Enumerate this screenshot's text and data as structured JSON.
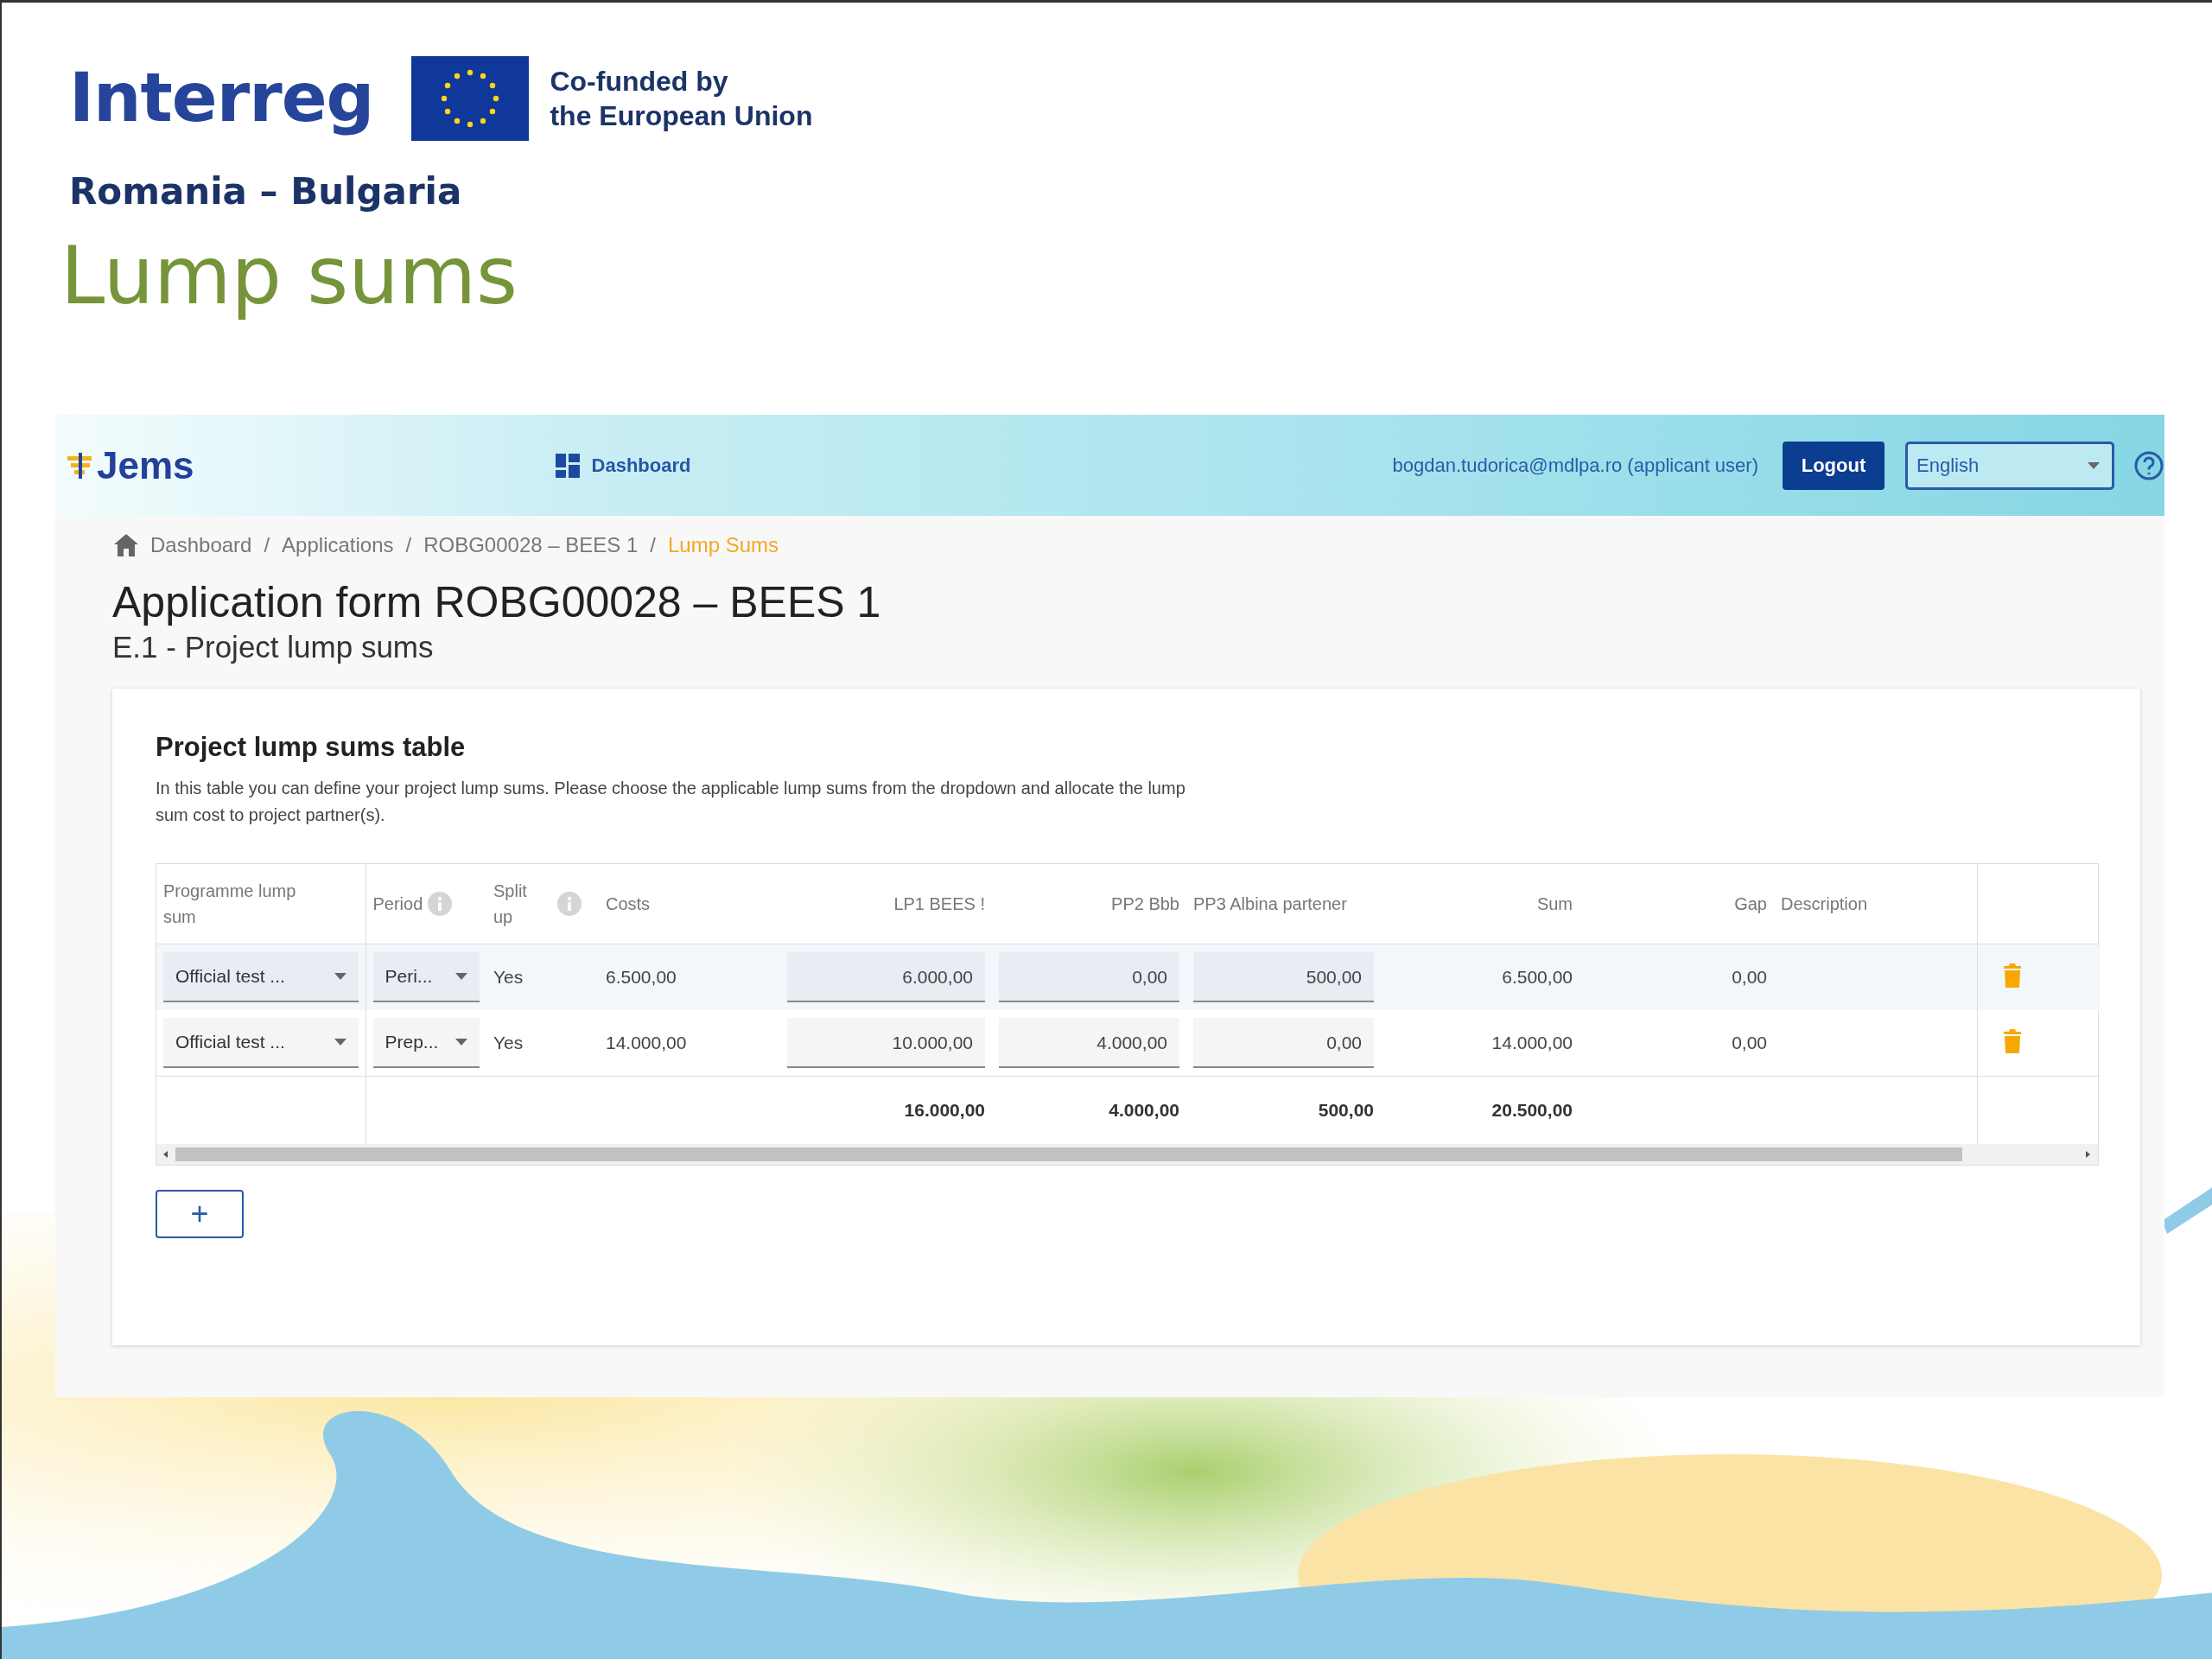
{
  "slide": {
    "programme_logo": "Interreg",
    "cofunded_lines": [
      "Co-funded by",
      "the European Union"
    ],
    "region": "Romania – Bulgaria",
    "title": "Lump sums"
  },
  "app": {
    "logo": "Jems",
    "nav": "Dashboard",
    "user": "bogdan.tudorica@mdlpa.ro (applicant user)",
    "logout": "Logout",
    "language": {
      "value": "English"
    }
  },
  "breadcrumb_separators": [
    "/",
    "/",
    "/"
  ],
  "breadcrumbs": [
    {
      "label": "Dashboard",
      "current": false
    },
    {
      "label": "Applications",
      "current": false
    },
    {
      "label": "ROBG00028 – BEES 1",
      "current": false
    },
    {
      "label": "Lump Sums",
      "current": true
    }
  ],
  "page_title": "Application form ROBG00028 – BEES 1",
  "page_subtitle": "E.1 - Project lump sums",
  "card": {
    "title": "Project lump sums table",
    "description": "In this table you can define your project lump sums. Please choose the applicable lump sums from the dropdown and allocate the lump sum cost to project partner(s).",
    "columns": [
      {
        "label": "Programme lump sum",
        "info": false
      },
      {
        "label": "Period",
        "info": true
      },
      {
        "label": "Split up",
        "info": true
      },
      {
        "label": "Costs",
        "info": false
      },
      {
        "label": "LP1 BEES !",
        "info": false
      },
      {
        "label": "PP2 Bbb",
        "info": false
      },
      {
        "label": "PP3 Albina partener",
        "info": false
      },
      {
        "label": "Sum",
        "info": false
      },
      {
        "label": "Gap",
        "info": false
      },
      {
        "label": "Description",
        "info": false
      }
    ],
    "rows": [
      {
        "selected": true,
        "lump_sum": "Official test ...",
        "period": "Peri...",
        "split_up": "Yes",
        "costs": "6.500,00",
        "partners": [
          "6.000,00",
          "0,00",
          "500,00"
        ],
        "sum": "6.500,00",
        "gap": "0,00"
      },
      {
        "selected": false,
        "lump_sum": "Official test ...",
        "period": "Prep...",
        "split_up": "Yes",
        "costs": "14.000,00",
        "partners": [
          "10.000,00",
          "4.000,00",
          "0,00"
        ],
        "sum": "14.000,00",
        "gap": "0,00"
      }
    ],
    "totals": {
      "partners": [
        "16.000,00",
        "4.000,00",
        "500,00"
      ],
      "sum": "20.500,00"
    },
    "add_button": "+"
  }
}
